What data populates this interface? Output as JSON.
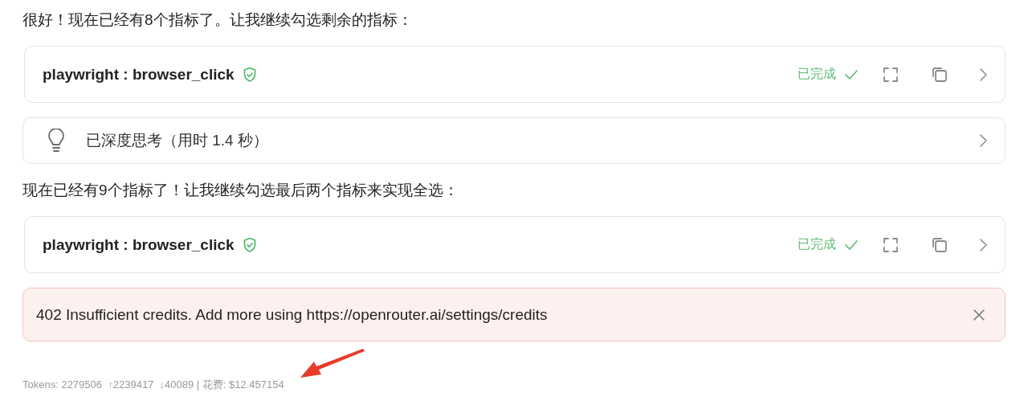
{
  "messages": [
    {
      "kind": "text",
      "text": "很好！现在已经有8个指标了。让我继续勾选剩余的指标："
    },
    {
      "kind": "tool",
      "name": "playwright : browser_click",
      "verified": true,
      "status": "已完成",
      "done": true
    },
    {
      "kind": "thinking",
      "text": "已深度思考（用时 1.4 秒）"
    },
    {
      "kind": "text",
      "text": "现在已经有9个指标了！让我继续勾选最后两个指标来实现全选："
    },
    {
      "kind": "tool",
      "name": "playwright : browser_click",
      "verified": true,
      "status": "已完成",
      "done": true
    },
    {
      "kind": "error",
      "text": "402 Insufficient credits. Add more using https://openrouter.ai/settings/credits"
    }
  ],
  "footer": {
    "usage": "Tokens: 2279506  ↑2239417  ↓40089 | 花费: $12.457154"
  },
  "annotation_arrow": true
}
